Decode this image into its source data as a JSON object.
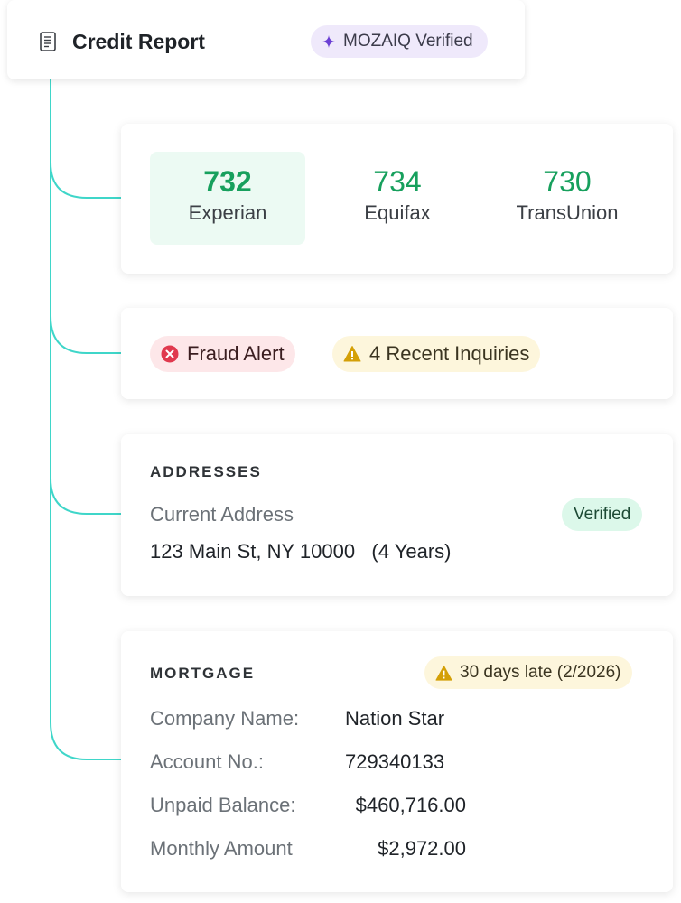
{
  "header": {
    "title": "Credit Report",
    "badge": "MOZAIQ Verified",
    "accent_color": "#6b3fd4"
  },
  "scores": [
    {
      "value": "732",
      "bureau": "Experian",
      "selected": true
    },
    {
      "value": "734",
      "bureau": "Equifax",
      "selected": false
    },
    {
      "value": "730",
      "bureau": "TransUnion",
      "selected": false
    }
  ],
  "alerts": {
    "fraud": "Fraud Alert",
    "inquiries": "4 Recent Inquiries"
  },
  "addresses": {
    "heading": "ADDRESSES",
    "label": "Current Address",
    "status": "Verified",
    "value": "123 Main St, NY 10000   (4 Years)"
  },
  "mortgage": {
    "heading": "MORTGAGE",
    "late_badge": "30 days late (2/2026)",
    "rows": [
      {
        "label": "Company Name:",
        "value": "Nation Star"
      },
      {
        "label": "Account No.:",
        "value": "729340133"
      },
      {
        "label": "Unpaid Balance:",
        "value": "$460,716.00"
      },
      {
        "label": "Monthly Amount",
        "value": "$2,972.00"
      }
    ]
  },
  "colors": {
    "connector": "#3fd6c9",
    "score_green": "#17a05d",
    "fraud_red": "#e0394e",
    "warning_amber": "#d4a007"
  },
  "icons": [
    "document-icon",
    "sparkle-icon",
    "error-circle-icon",
    "warning-triangle-icon"
  ]
}
